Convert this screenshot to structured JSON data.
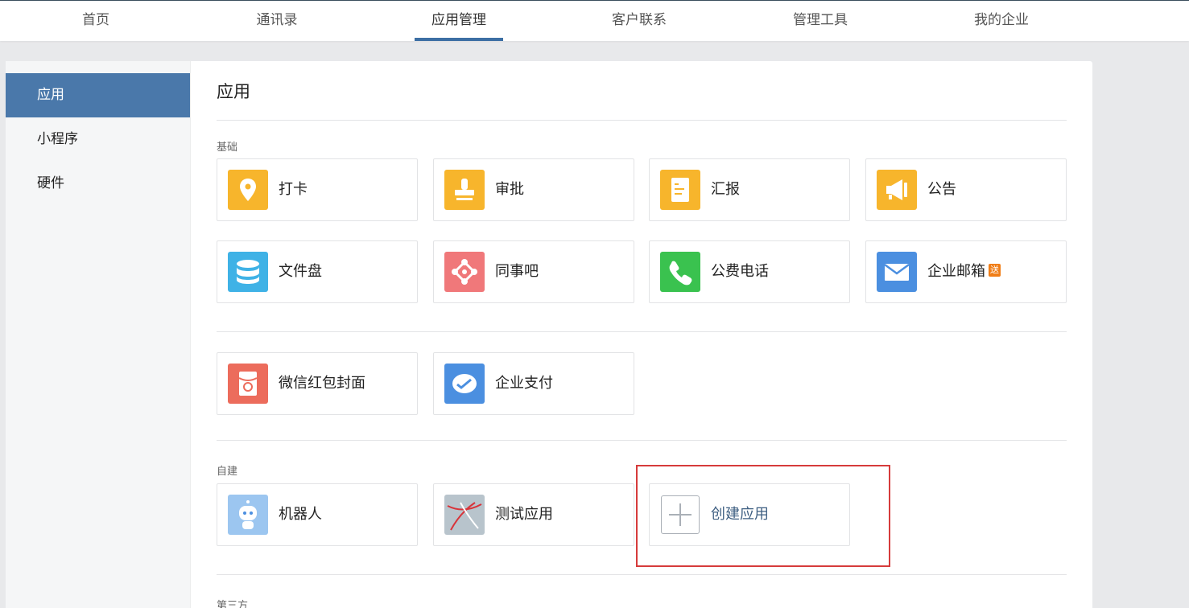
{
  "nav": {
    "tabs": [
      {
        "label": "首页"
      },
      {
        "label": "通讯录"
      },
      {
        "label": "应用管理"
      },
      {
        "label": "客户联系"
      },
      {
        "label": "管理工具"
      },
      {
        "label": "我的企业"
      }
    ],
    "active_tab": "应用管理"
  },
  "sidebar": {
    "items": [
      {
        "label": "应用"
      },
      {
        "label": "小程序"
      },
      {
        "label": "硬件"
      }
    ],
    "active_item": "应用"
  },
  "main": {
    "title": "应用",
    "sections": {
      "basic": {
        "label": "基础",
        "apps": [
          {
            "label": "打卡",
            "icon": "location-pin-icon",
            "color": "#f7b52c"
          },
          {
            "label": "审批",
            "icon": "stamp-icon",
            "color": "#f7b52c"
          },
          {
            "label": "汇报",
            "icon": "report-icon",
            "color": "#f7b52c"
          },
          {
            "label": "公告",
            "icon": "megaphone-icon",
            "color": "#f7b52c"
          },
          {
            "label": "文件盘",
            "icon": "database-icon",
            "color": "#3fb2e6"
          },
          {
            "label": "同事吧",
            "icon": "network-icon",
            "color": "#f0787a"
          },
          {
            "label": "公费电话",
            "icon": "phone-icon",
            "color": "#3ac24f"
          },
          {
            "label": "企业邮箱",
            "icon": "mail-icon",
            "color": "#4b8fe0",
            "badge": "送"
          }
        ]
      },
      "extra": {
        "apps": [
          {
            "label": "微信红包封面",
            "icon": "red-envelope-icon",
            "color": "#ec6c5c"
          },
          {
            "label": "企业支付",
            "icon": "wechat-pay-icon",
            "color": "#4b8fe0"
          }
        ]
      },
      "custom": {
        "label": "自建",
        "apps": [
          {
            "label": "机器人",
            "icon": "robot-icon",
            "color": "#9cc6f0"
          },
          {
            "label": "测试应用",
            "icon": "test-app-icon",
            "color": "#b8c4cc"
          }
        ],
        "create_label": "创建应用"
      },
      "third_party": {
        "label": "第三方"
      }
    }
  }
}
